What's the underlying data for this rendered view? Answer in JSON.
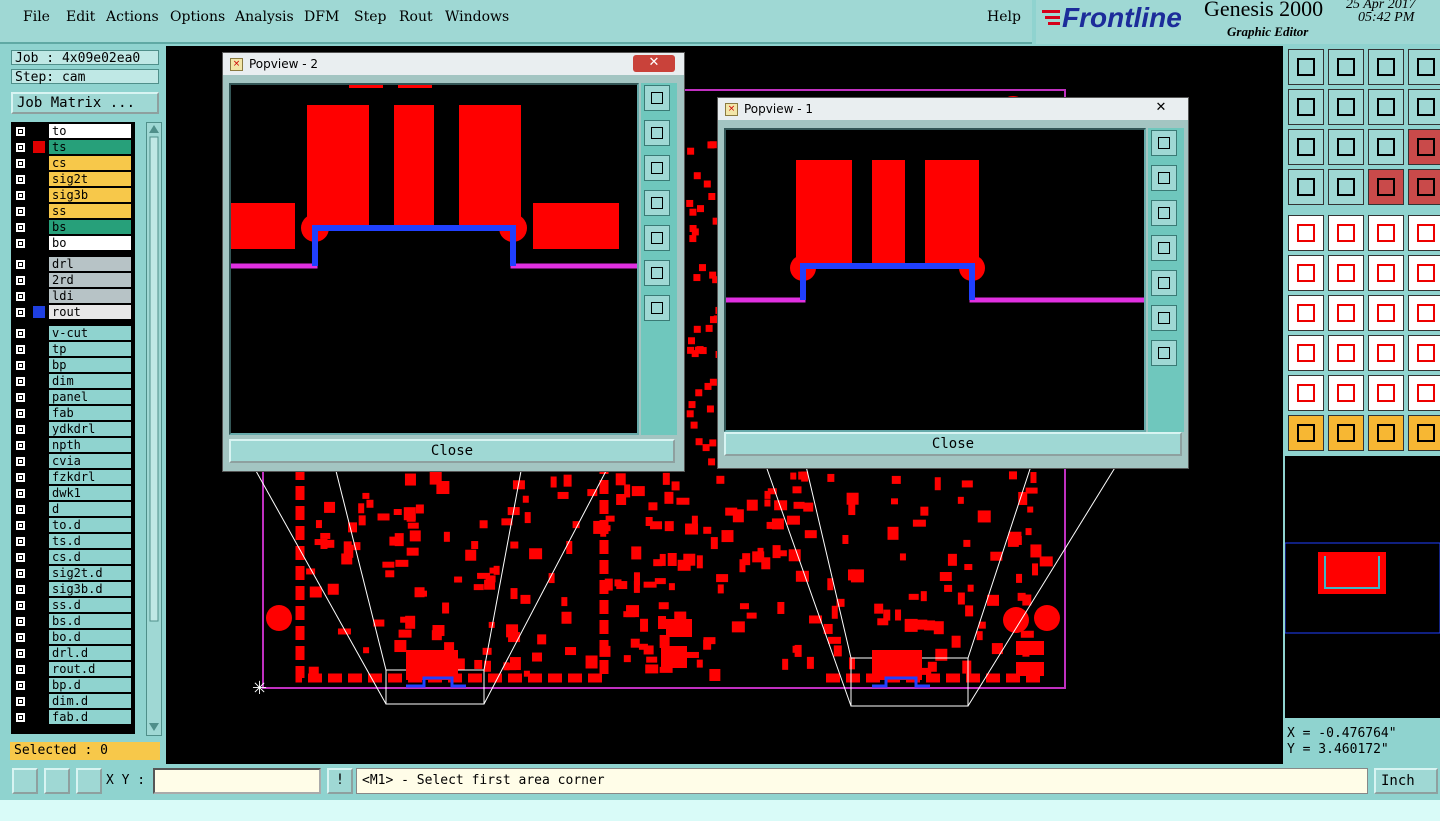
{
  "menu": [
    "File",
    "Edit",
    "Actions",
    "Options",
    "Analysis",
    "DFM",
    "Step",
    "Rout",
    "Windows"
  ],
  "help": "Help",
  "brand": {
    "logo": "Frontline",
    "product": "Genesis 2000",
    "subtitle": "Graphic Editor",
    "date": "25 Apr 2017",
    "time": "05:42 PM"
  },
  "job": {
    "job_label": "Job : 4x09e02ea0",
    "step_label": "Step: cam",
    "matrix_button": "Job Matrix ..."
  },
  "layers": [
    {
      "name": "to",
      "color": "#ffffff",
      "swatch": ""
    },
    {
      "name": "ts",
      "color": "#27a07a",
      "swatch": "#e00000"
    },
    {
      "name": "cs",
      "color": "#f7c84a",
      "swatch": ""
    },
    {
      "name": "sig2t",
      "color": "#f7c84a",
      "swatch": ""
    },
    {
      "name": "sig3b",
      "color": "#f7c84a",
      "swatch": ""
    },
    {
      "name": "ss",
      "color": "#f7c84a",
      "swatch": ""
    },
    {
      "name": "bs",
      "color": "#27a07a",
      "swatch": ""
    },
    {
      "name": "bo",
      "color": "#ffffff",
      "swatch": ""
    },
    {
      "name": "drl",
      "color": "#b7c3c6",
      "swatch": ""
    },
    {
      "name": "2rd",
      "color": "#b7c3c6",
      "swatch": ""
    },
    {
      "name": "ldi",
      "color": "#b7c3c6",
      "swatch": ""
    },
    {
      "name": "rout",
      "color": "#e7e7e7",
      "swatch": "#1f3fe0"
    },
    {
      "name": "v-cut",
      "color": "#8fd3cf",
      "swatch": ""
    },
    {
      "name": "tp",
      "color": "#8fd3cf",
      "swatch": ""
    },
    {
      "name": "bp",
      "color": "#8fd3cf",
      "swatch": ""
    },
    {
      "name": "dim",
      "color": "#8fd3cf",
      "swatch": ""
    },
    {
      "name": "panel",
      "color": "#8fd3cf",
      "swatch": ""
    },
    {
      "name": "fab",
      "color": "#8fd3cf",
      "swatch": ""
    },
    {
      "name": "ydkdrl",
      "color": "#8fd3cf",
      "swatch": ""
    },
    {
      "name": "npth",
      "color": "#8fd3cf",
      "swatch": ""
    },
    {
      "name": "cvia",
      "color": "#8fd3cf",
      "swatch": ""
    },
    {
      "name": "fzkdrl",
      "color": "#8fd3cf",
      "swatch": ""
    },
    {
      "name": "dwk1",
      "color": "#8fd3cf",
      "swatch": ""
    },
    {
      "name": "d",
      "color": "#8fd3cf",
      "swatch": ""
    },
    {
      "name": "to.d",
      "color": "#8fd3cf",
      "swatch": ""
    },
    {
      "name": "ts.d",
      "color": "#8fd3cf",
      "swatch": ""
    },
    {
      "name": "cs.d",
      "color": "#8fd3cf",
      "swatch": ""
    },
    {
      "name": "sig2t.d",
      "color": "#8fd3cf",
      "swatch": ""
    },
    {
      "name": "sig3b.d",
      "color": "#8fd3cf",
      "swatch": ""
    },
    {
      "name": "ss.d",
      "color": "#8fd3cf",
      "swatch": ""
    },
    {
      "name": "bs.d",
      "color": "#8fd3cf",
      "swatch": ""
    },
    {
      "name": "bo.d",
      "color": "#8fd3cf",
      "swatch": ""
    },
    {
      "name": "drl.d",
      "color": "#8fd3cf",
      "swatch": ""
    },
    {
      "name": "rout.d",
      "color": "#8fd3cf",
      "swatch": ""
    },
    {
      "name": "bp.d",
      "color": "#8fd3cf",
      "swatch": ""
    },
    {
      "name": "dim.d",
      "color": "#8fd3cf",
      "swatch": ""
    },
    {
      "name": "fab.d",
      "color": "#8fd3cf",
      "swatch": ""
    }
  ],
  "selected": "Selected : 0",
  "popview2": {
    "title": "Popview - 2",
    "close_label": "Close"
  },
  "popview1": {
    "title": "Popview - 1",
    "close_label": "Close"
  },
  "coords": {
    "x": "X = -0.476764\"",
    "y": "Y = 3.460172\""
  },
  "xy_label": "X Y :",
  "prompt": "<M1> - Select first area corner",
  "units": "Inch"
}
